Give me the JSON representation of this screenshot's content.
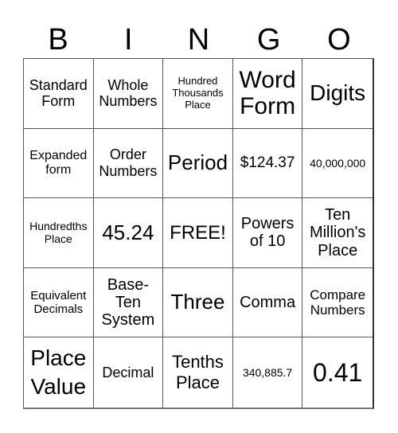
{
  "header": {
    "letters": [
      "B",
      "I",
      "N",
      "G",
      "O"
    ]
  },
  "card": {
    "cells": [
      "Standard\nForm",
      "Whole\nNumbers",
      "Hundred\nThousands\nPlace",
      "Word\nForm",
      "Digits",
      "Expanded\nform",
      "Order\nNumbers",
      "Period",
      "$124.37",
      "40,000,000",
      "Hundredths\nPlace",
      "45.24",
      "FREE!",
      "Powers\nof 10",
      "Ten\nMillion's\nPlace",
      "Equivalent\nDecimals",
      "Base-\nTen\nSystem",
      "Three",
      "Comma",
      "Compare\nNumbers",
      "Place\nValue",
      "Decimal",
      "Tenths\nPlace",
      "340,885.7",
      "0.41"
    ]
  }
}
